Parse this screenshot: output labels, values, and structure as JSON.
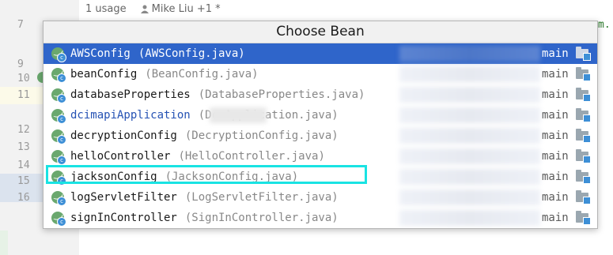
{
  "editor": {
    "usage_hint": "1 usage",
    "author_hint": "Mike Liu +1 *",
    "line_numbers": [
      "7",
      "9",
      "10",
      "11",
      "12",
      "13",
      "14",
      "15",
      "16"
    ],
    "fragment_right": "m."
  },
  "popup": {
    "title": "Choose Bean",
    "items": [
      {
        "name": "AWSConfig",
        "file": "(AWSConfig.java)",
        "module": "main",
        "link": false
      },
      {
        "name": "beanConfig",
        "file": "(BeanConfig.java)",
        "module": "main",
        "link": false
      },
      {
        "name": "databaseProperties",
        "file": "(DatabaseProperties.java)",
        "module": "main",
        "link": false
      },
      {
        "name": "dcimapiApplication",
        "file": "(Dc        Application.java)",
        "module": "main",
        "link": true
      },
      {
        "name": "decryptionConfig",
        "file": "(DecryptionConfig.java)",
        "module": "main",
        "link": false
      },
      {
        "name": "helloController",
        "file": "(HelloController.java)",
        "module": "main",
        "link": false
      },
      {
        "name": "jacksonConfig",
        "file": "(JacksonConfig.java)",
        "module": "main",
        "link": false
      },
      {
        "name": "logServletFilter",
        "file": "(LogServletFilter.java)",
        "module": "main",
        "link": false
      },
      {
        "name": "signInController",
        "file": "(SignInController.java)",
        "module": "main",
        "link": false
      }
    ],
    "selected_index": 0,
    "highlighted_index": 6
  },
  "colors": {
    "selection": "#2f65ca",
    "bean_icon": "#6aa86e",
    "highlight_box": "#19e3e3"
  },
  "icons": {
    "bean": "spring-bean-icon",
    "module": "module-folder-icon",
    "author": "person-icon"
  }
}
